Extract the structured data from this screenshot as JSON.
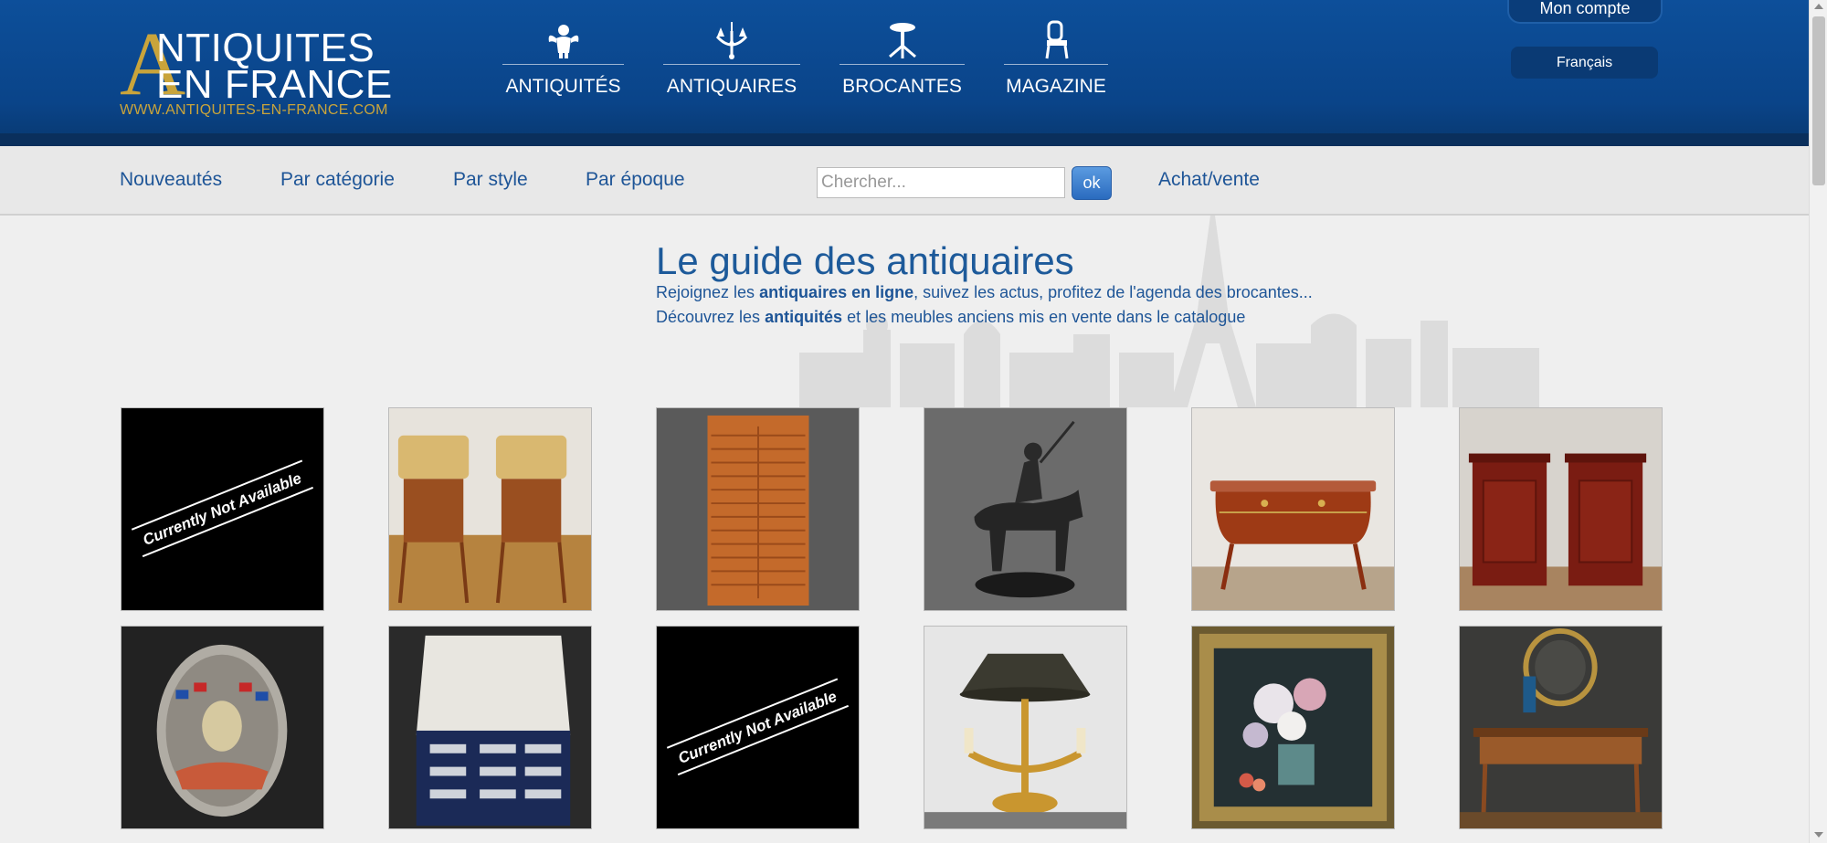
{
  "logo": {
    "letter": "A",
    "line1": "NTIQUITES",
    "line2": "EN FRANCE",
    "url": "WWW.ANTIQUITES-EN-FRANCE.COM",
    "color_gold": "#c9a43b"
  },
  "main_nav": [
    {
      "label": "ANTIQUITÉS",
      "icon": "cherub-icon"
    },
    {
      "label": "ANTIQUAIRES",
      "icon": "chandelier-icon"
    },
    {
      "label": "BROCANTES",
      "icon": "pedestal-table-icon"
    },
    {
      "label": "MAGAZINE",
      "icon": "chair-icon"
    }
  ],
  "account": {
    "label": "Mon compte"
  },
  "language": {
    "label": "Français"
  },
  "subnav": {
    "items": [
      "Nouveautés",
      "Par catégorie",
      "Par style",
      "Par époque"
    ],
    "achat": "Achat/vente"
  },
  "search": {
    "placeholder": "Chercher...",
    "value": "",
    "button": "ok"
  },
  "hero": {
    "title": "Le guide des antiquaires",
    "line1_pre": "Rejoignez les ",
    "line1_bold": "antiquaires en ligne",
    "line1_post": ", suivez les actus, profitez de l'agenda des brocantes...",
    "line2_pre": "Découvrez les ",
    "line2_bold": "antiquités",
    "line2_post": " et les meubles anciens mis en vente dans le catalogue"
  },
  "unavailable_text": "Currently Not Available",
  "products": [
    {
      "name": "unavailable",
      "kind": "unavailable"
    },
    {
      "name": "pair-nightstands-marble",
      "kind": "nightstands"
    },
    {
      "name": "tambour-cabinet",
      "kind": "tambour"
    },
    {
      "name": "bronze-horseman",
      "kind": "bronze"
    },
    {
      "name": "louis-xv-commode",
      "kind": "commode"
    },
    {
      "name": "pair-mahogany-cabinets",
      "kind": "cabinets"
    },
    {
      "name": "rally-plaque",
      "kind": "plaque"
    },
    {
      "name": "cutlery-case",
      "kind": "cutlery"
    },
    {
      "name": "unavailable",
      "kind": "unavailable"
    },
    {
      "name": "bouillotte-lamp",
      "kind": "lamp"
    },
    {
      "name": "flower-painting",
      "kind": "painting"
    },
    {
      "name": "writing-desk",
      "kind": "desk"
    }
  ],
  "colors": {
    "header_blue": "#0d4f9a",
    "link_blue": "#1e5597",
    "title_blue": "#1d5a9a"
  }
}
